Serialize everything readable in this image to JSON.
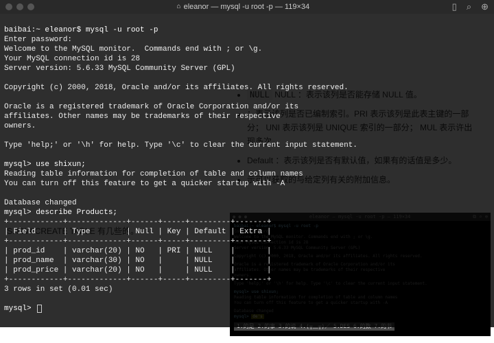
{
  "titlebar": {
    "title": "eleanor — mysql -u root -p — 119×34"
  },
  "term": {
    "line_prompt1": "baibai:~ eleanor$ mysql -u root -p",
    "line_enterpw": "Enter password:",
    "line_welcome": "Welcome to the MySQL monitor.  Commands end with ; or \\g.",
    "line_connid": "Your MySQL connection id is 28",
    "line_server": "Server version: 5.6.33 MySQL Community Server (GPL)",
    "line_copy": "Copyright (c) 2000, 2018, Oracle and/or its affiliates. All rights reserved.",
    "line_tm1": "Oracle is a registered trademark of Oracle Corporation and/or its",
    "line_tm2": "affiliates. Other names may be trademarks of their respective",
    "line_tm3": "owners.",
    "line_help": "Type 'help;' or '\\h' for help. Type '\\c' to clear the current input statement.",
    "line_use": "mysql> use shixun;",
    "line_read1": "Reading table information for completion of table and column names",
    "line_read2": "You can turn off this feature to get a quicker startup with -A",
    "line_dbchanged": "Database changed",
    "line_describe": "mysql> describe Products;",
    "tbl_sep": "+------------+-------------+------+-----+---------+-------+",
    "tbl_hdr": "| Field      | Type        | Null | Key | Default | Extra |",
    "tbl_r1": "| prod_id    | varchar(20) | NO   | PRI | NULL    |       |",
    "tbl_r2": "| prod_name  | varchar(30) | NO   |     | NULL    |       |",
    "tbl_r3": "| prod_price | varchar(20) | NO   |     | NULL    |       |",
    "line_rows": "3 rows in set (0.01 sec)",
    "line_prompt_end": "mysql> "
  },
  "bg": {
    "li1_a": "NULL ：表示该列是否能存储 NULL 值。",
    "li2_a": "：表示该列是否已编制索引。PRI 表示该列是此表主键的一部分； UNI 表示该列是 UNIQUE  索引的一部分； MUL 表示许出现多次。",
    "li3_a": "Default ：表示该列是否有默认值，如果有的话值是多少。",
    "li4_a": "示可以获取的与给定列有关的附加信息。",
    "bl1": "SHOW CREATE TABLE 有几些的。"
  },
  "thumb": {
    "title": "eleanor — mysql -u root -p — 119×34",
    "l1": "baibai:~ eleanor$ mysql -u root -p",
    "l2": "Enter password:",
    "l3": "Welcome to the MySQL monitor.  Commands end with ; or \\g.",
    "l4": "Your MySQL connection id is 28",
    "l5": "Server version: 5.6.33 MySQL Community Server (GPL)",
    "l6": "Copyright (c) 2000, 2018, Oracle and/or its affiliates. All rights reserved.",
    "l7": "Oracle is a registered trademark of Oracle Corporation and/or its",
    "l8": "affiliates. Other names may be trademarks of their respective",
    "l9": "owners.",
    "l10": "Type 'help;' or '\\h' for help. Type '\\c' to clear the current input statement.",
    "l11": "mysql> use shixun;",
    "l12": "Reading table information for completion of table and column names",
    "l13": "You can turn off this feature to get a quicker startup with -A",
    "l14": "Database changed",
    "l15": "mysql> ",
    "highlight": "de's",
    "ime": "1.的是 2.的事 3.的说 4.(┬＿┬)／ 5.DES 6.的数 7.的书"
  }
}
